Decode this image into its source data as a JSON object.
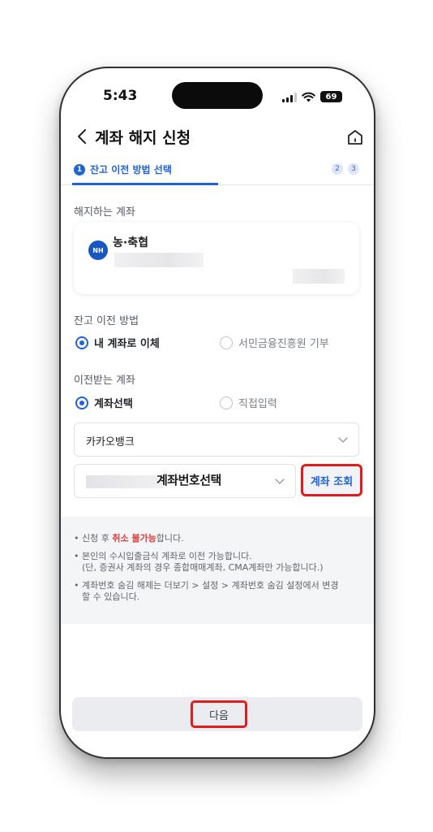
{
  "status_bar": {
    "time": "5:43",
    "battery": "69"
  },
  "header": {
    "title": "계좌 해지 신청"
  },
  "steps": {
    "active_number": "1",
    "active_label": "잔고 이전 방법 선택",
    "step2": "2",
    "step3": "3"
  },
  "account_section": {
    "label": "해지하는 계좌",
    "bank_logo": "NH",
    "bank_name": "농·축협"
  },
  "transfer_method": {
    "label": "잔고 이전 방법",
    "options": [
      {
        "label": "내 계좌로 이체",
        "selected": true
      },
      {
        "label": "서민금융진흥원 기부",
        "selected": false
      }
    ]
  },
  "receiving_account": {
    "label": "이전받는 계좌",
    "options": [
      {
        "label": "계좌선택",
        "selected": true
      },
      {
        "label": "직접입력",
        "selected": false
      }
    ],
    "bank_select_value": "카카오뱅크",
    "account_select_overlay": "계좌번호선택",
    "lookup_button": "계좌 조회"
  },
  "notices": [
    {
      "before": "신청 후 ",
      "highlight": "취소 불가능",
      "after": "합니다."
    },
    {
      "line1": "본인의 수시입출금식 계좌로 이전 가능합니다.",
      "line2": "(단, 증권사 계좌의 경우 종합매매계좌, CMA계좌만 가능합니다.)"
    },
    {
      "line1": "계좌번호 숨김 해제는 더보기 > 설정 > 계좌번호 숨김 설정에서 변경",
      "line2": "할 수 있습니다."
    }
  ],
  "bottom": {
    "next_button": "다음"
  },
  "colors": {
    "accent": "#1e64d8",
    "highlight_border": "#e21c1c",
    "warning_text": "#e23a3a"
  },
  "icons": {
    "back": "chevron-left-icon",
    "home": "home-icon",
    "dropdown": "chevron-down-icon",
    "signal": "signal-icon",
    "wifi": "wifi-icon",
    "battery": "battery-icon"
  }
}
